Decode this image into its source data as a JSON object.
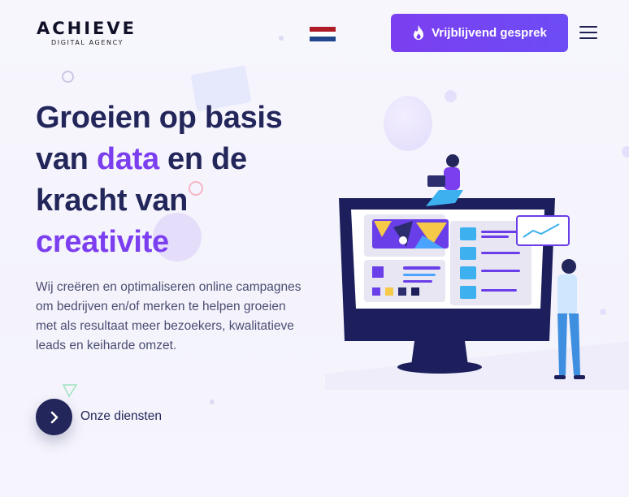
{
  "header": {
    "logo_main": "ACHIEVE",
    "logo_sub": "DIGITAL AGENCY",
    "flag_icon": "netherlands-flag-icon",
    "cta_label": "Vrijblijvend gesprek",
    "cta_icon": "flame-icon",
    "menu_icon": "hamburger-menu-icon"
  },
  "hero": {
    "headline_part1": "Groeien op basis van ",
    "headline_highlight1": "data",
    "headline_part2": " en de kracht van ",
    "headline_highlight2": "creativite",
    "description": "Wij creëren en optimaliseren online campagnes om bedrijven en/of merken te helpen groeien met als resultaat meer bezoekers, kwalitatieve leads en keiharde omzet.",
    "button_icon": "chevron-right-icon",
    "button_label": "Onze diensten",
    "illustration": "monitor-dashboard-illustration"
  },
  "colors": {
    "accent": "#7b3ff0",
    "navy": "#23265a",
    "flag_red": "#ae1c28",
    "flag_white": "#ffffff",
    "flag_blue": "#21468b"
  }
}
